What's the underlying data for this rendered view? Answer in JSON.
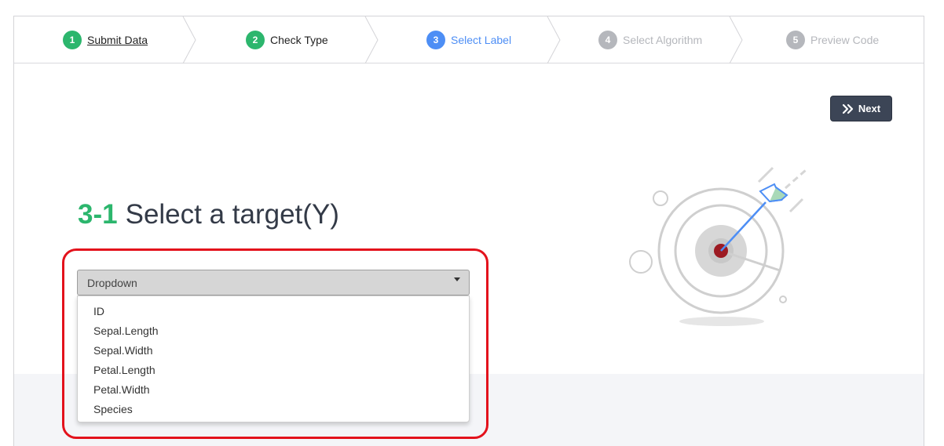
{
  "stepper": {
    "steps": [
      {
        "number": "1",
        "label": "Submit Data",
        "state": "done"
      },
      {
        "number": "2",
        "label": "Check Type",
        "state": "done"
      },
      {
        "number": "3",
        "label": "Select Label",
        "state": "current"
      },
      {
        "number": "4",
        "label": "Select Algorithm",
        "state": "todo"
      },
      {
        "number": "5",
        "label": "Preview Code",
        "state": "todo"
      }
    ]
  },
  "toolbar": {
    "next_label": "Next"
  },
  "section": {
    "number": "3-1",
    "title": "Select a target(Y)"
  },
  "dropdown": {
    "selected": "Dropdown",
    "options": [
      "ID",
      "Sepal.Length",
      "Sepal.Width",
      "Petal.Length",
      "Petal.Width",
      "Species"
    ]
  },
  "colors": {
    "done": "#2cb66d",
    "current": "#4d8ef5",
    "todo": "#b5b7bc",
    "highlight": "#e3121c"
  }
}
